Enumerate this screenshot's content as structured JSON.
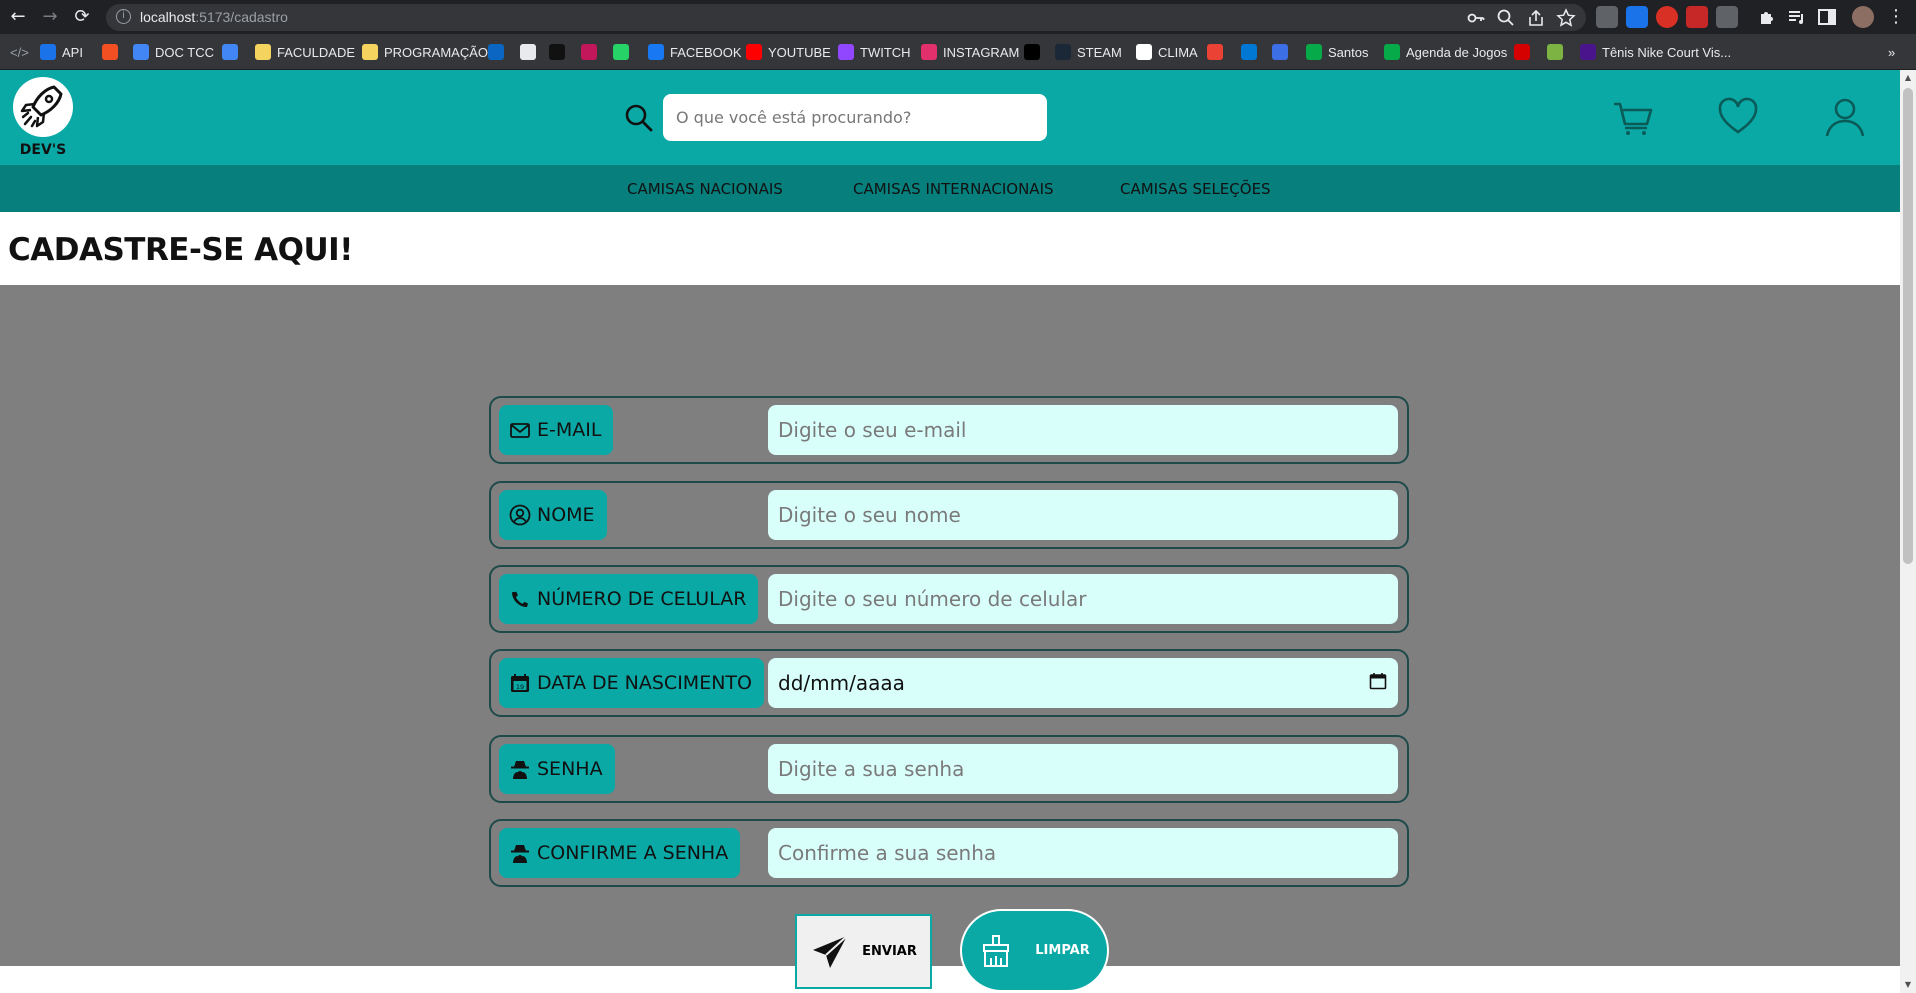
{
  "browser": {
    "url_host": "localhost",
    "url_path": ":5173/cadastro",
    "bookmarks": [
      {
        "label": "API",
        "color": "#1a73e8"
      },
      {
        "label": "",
        "color": "#f25022"
      },
      {
        "label": "DOC TCC",
        "color": "#4285f4"
      },
      {
        "label": "",
        "color": "#4285f4"
      },
      {
        "label": "FACULDADE",
        "color": "#f4d35e"
      },
      {
        "label": "PROGRAMAÇÃO",
        "color": "#f4d35e"
      },
      {
        "label": "",
        "color": "#0a66c2"
      },
      {
        "label": "",
        "color": "#e8eaed"
      },
      {
        "label": "",
        "color": "#111111"
      },
      {
        "label": "",
        "color": "#c2185b"
      },
      {
        "label": "",
        "color": "#25d366"
      },
      {
        "label": "FACEBOOK",
        "color": "#1877f2"
      },
      {
        "label": "YOUTUBE",
        "color": "#ff0000"
      },
      {
        "label": "TWITCH",
        "color": "#9146ff"
      },
      {
        "label": "INSTAGRAM",
        "color": "#e1306c"
      },
      {
        "label": "",
        "color": "#000000"
      },
      {
        "label": "STEAM",
        "color": "#1b2838"
      },
      {
        "label": "CLIMA",
        "color": "#ffffff"
      },
      {
        "label": "",
        "color": "#ea4335"
      },
      {
        "label": "",
        "color": "#0078d4"
      },
      {
        "label": "",
        "color": "#3c6ee6"
      },
      {
        "label": "Santos",
        "color": "#06aa48"
      },
      {
        "label": "Agenda de Jogos",
        "color": "#06aa48"
      },
      {
        "label": "",
        "color": "#d50000"
      },
      {
        "label": "",
        "color": "#7cb342"
      },
      {
        "label": "Tênis Nike Court Vis...",
        "color": "#4a148c"
      }
    ]
  },
  "header": {
    "logo_text": "DEV'S",
    "search_placeholder": "O que você está procurando?"
  },
  "categories": [
    "CAMISAS NACIONAIS",
    "CAMISAS INTERNACIONAIS",
    "CAMISAS SELEÇÕES"
  ],
  "page_title": "CADASTRE-SE AQUI!",
  "form": {
    "fields": [
      {
        "label": "E-MAIL",
        "icon": "mail-icon",
        "placeholder": "Digite o seu e-mail"
      },
      {
        "label": "NOME",
        "icon": "user-circle-icon",
        "placeholder": "Digite o seu nome"
      },
      {
        "label": "NÚMERO DE CELULAR",
        "icon": "phone-icon",
        "placeholder": "Digite o seu número de celular"
      },
      {
        "label": "DATA DE NASCIMENTO",
        "icon": "calendar-icon",
        "placeholder": "dd/mm/aaaa"
      },
      {
        "label": "SENHA",
        "icon": "spy-icon",
        "placeholder": "Digite a sua senha"
      },
      {
        "label": "CONFIRME A SENHA",
        "icon": "spy-icon",
        "placeholder": "Confirme a sua senha"
      }
    ],
    "submit_label": "ENVIAR",
    "clear_label": "LIMPAR"
  },
  "colors": {
    "primary": "#0aa9a5",
    "primary_dark": "#077f7c",
    "form_bg": "#7f7f7f",
    "input_bg": "#d9fffb"
  }
}
